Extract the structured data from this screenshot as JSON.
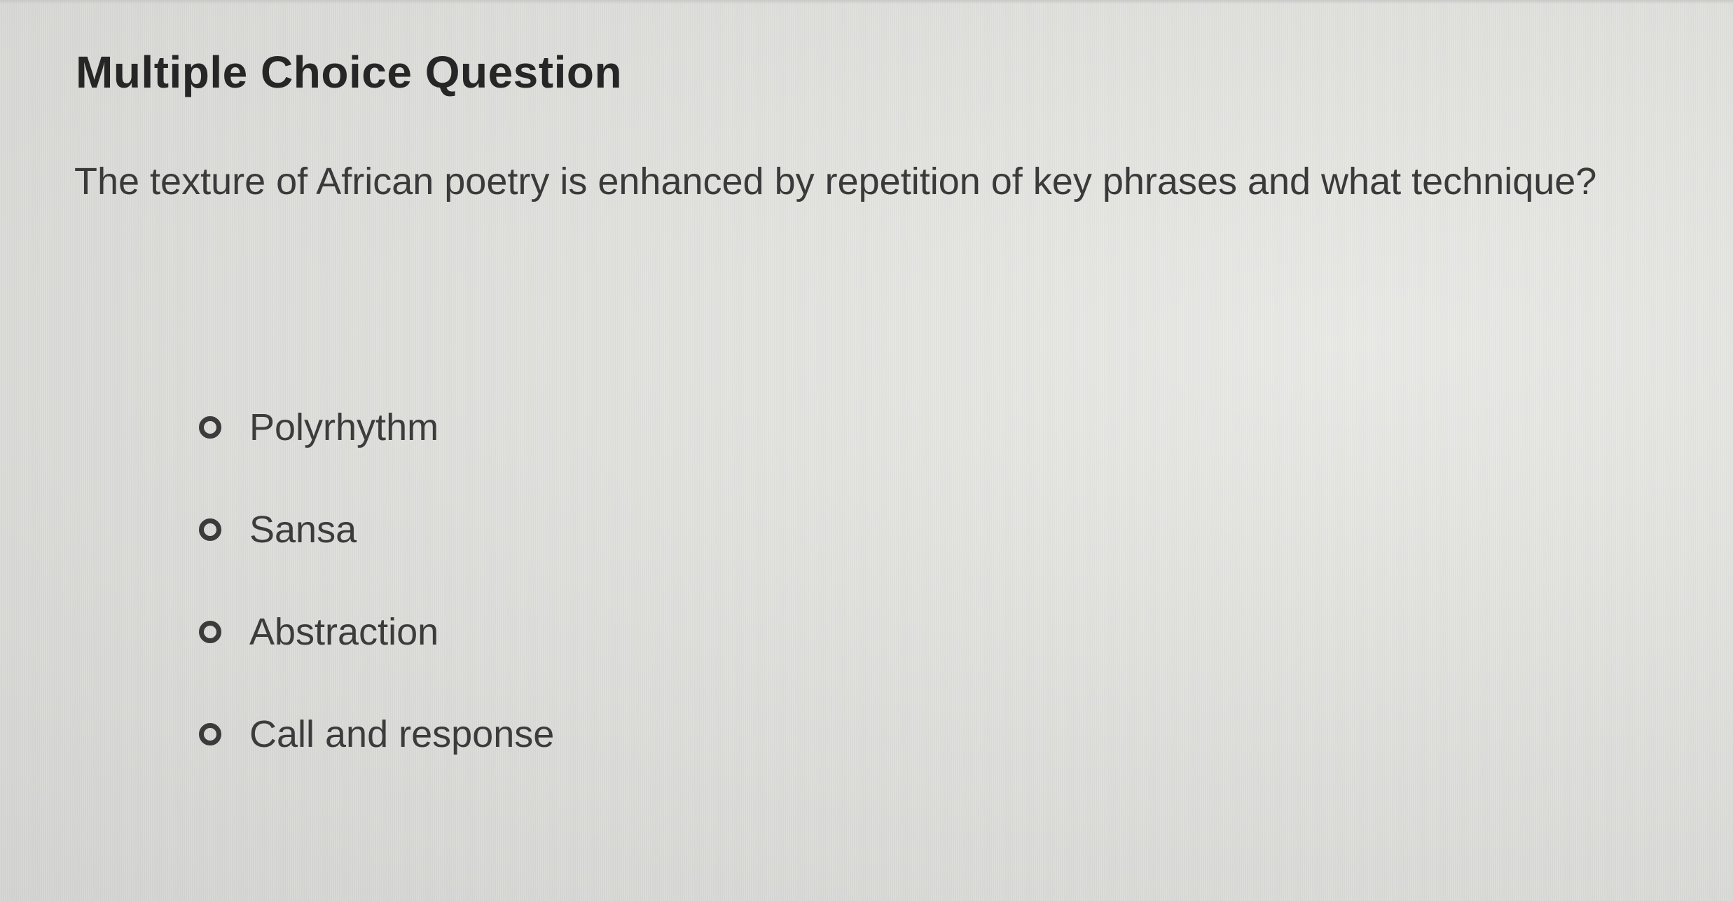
{
  "question": {
    "type_label": "Multiple Choice Question",
    "prompt": "The texture of African poetry is enhanced by repetition of key phrases and what technique?"
  },
  "options": [
    {
      "label": "Polyrhythm",
      "selected": false
    },
    {
      "label": "Sansa",
      "selected": false
    },
    {
      "label": "Abstraction",
      "selected": false
    },
    {
      "label": "Call and response",
      "selected": false
    }
  ],
  "colors": {
    "text_primary": "#262626",
    "text_secondary": "#3c3c3c",
    "radio_border": "#3b3b3b",
    "background": "#dcdcda"
  }
}
